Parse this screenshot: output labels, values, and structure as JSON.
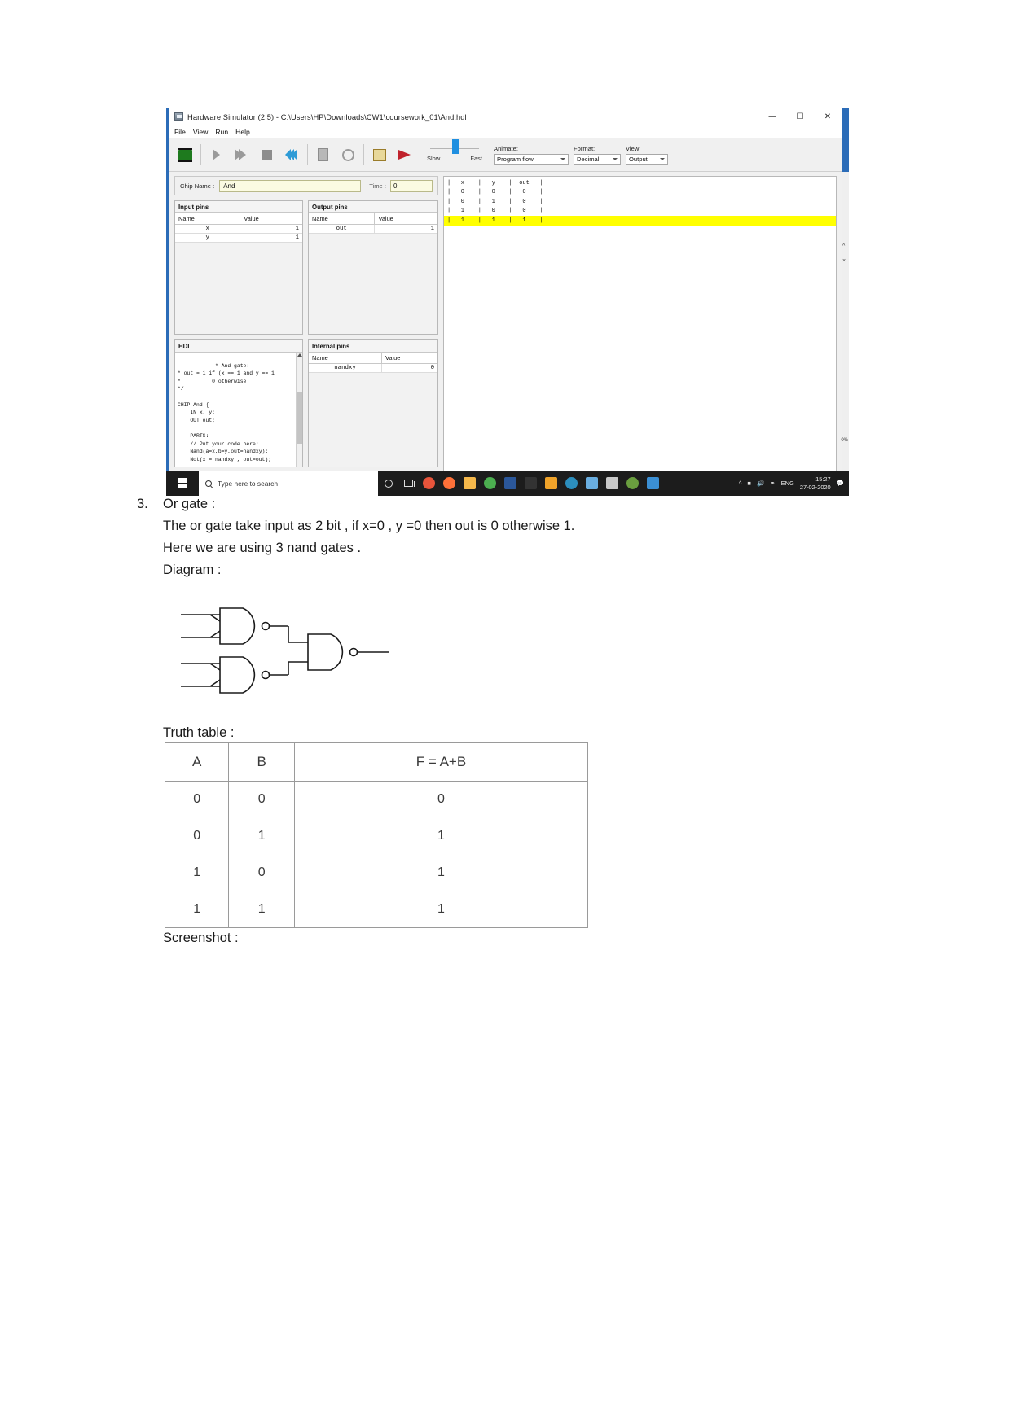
{
  "document": {
    "item_number": "3.",
    "lines": [
      "Or gate :",
      "The or gate take input as 2 bit , if x=0 , y =0 then out is 0 otherwise 1.",
      "Here we are using 3 nand gates .",
      "Diagram :"
    ],
    "truth_table_label": "Truth table :",
    "screenshot_label": "Screenshot :"
  },
  "truth_table": {
    "headers": [
      "A",
      "B",
      "F = A+B"
    ],
    "rows": [
      [
        "0",
        "0",
        "0"
      ],
      [
        "0",
        "1",
        "1"
      ],
      [
        "1",
        "0",
        "1"
      ],
      [
        "1",
        "1",
        "1"
      ]
    ]
  },
  "simulator": {
    "window_title": "Hardware Simulator (2.5) - C:\\Users\\HP\\Downloads\\CW1\\coursework_01\\And.hdl",
    "window_buttons": {
      "minimize": "—",
      "maximize": "☐",
      "close": "✕"
    },
    "menu": [
      "File",
      "View",
      "Run",
      "Help"
    ],
    "toolbar": {
      "icons": [
        "chip-icon",
        "step-icon",
        "fast-forward-icon",
        "stop-icon",
        "rewind-icon",
        "script-icon",
        "clock-icon",
        "compare-icon",
        "flag-icon"
      ],
      "speed_slow_label": "Slow",
      "speed_fast_label": "Fast",
      "animate_label": "Animate:",
      "animate_value": "Program flow",
      "format_label": "Format:",
      "format_value": "Decimal",
      "view_label": "View:",
      "view_value": "Output"
    },
    "chip": {
      "name_label": "Chip Name :",
      "name_value": "And",
      "time_label": "Time :",
      "time_value": "0"
    },
    "input_pins": {
      "title": "Input pins",
      "columns": [
        "Name",
        "Value"
      ],
      "rows": [
        {
          "name": "x",
          "value": "1"
        },
        {
          "name": "y",
          "value": "1"
        }
      ]
    },
    "output_pins": {
      "title": "Output pins",
      "columns": [
        "Name",
        "Value"
      ],
      "rows": [
        {
          "name": "out",
          "value": "1"
        }
      ]
    },
    "hdl": {
      "title": "HDL",
      "code": "* And gate:\n* out = 1 if (x == 1 and y == 1\n*          0 otherwise\n*/\n\nCHIP And {\n    IN x, y;\n    OUT out;\n\n    PARTS:\n    // Put your code here:\n    Nand(a=x,b=y,out=nandxy);\n    Not(x = nandxy , out=out);"
    },
    "internal_pins": {
      "title": "Internal pins",
      "columns": [
        "Name",
        "Value"
      ],
      "rows": [
        {
          "name": "nandxy",
          "value": "0"
        }
      ]
    },
    "sim_output": {
      "header": "|   x    |   y    |  out   |",
      "rows": [
        {
          "text": "|   0    |   0    |   0    |",
          "highlight": false
        },
        {
          "text": "|   0    |   1    |   0    |",
          "highlight": false
        },
        {
          "text": "|   1    |   0    |   0    |",
          "highlight": false
        },
        {
          "text": "|   1    |   1    |   1    |",
          "highlight": true
        }
      ]
    },
    "zoom_level": "0%"
  },
  "taskbar": {
    "search_placeholder": "Type here to search",
    "language": "ENG",
    "time": "15:27",
    "date": "27-02-2020",
    "app_colors": [
      "#e8543b",
      "#ff7139",
      "#f5b84b",
      "#4caf50",
      "#2b579a",
      "#333333",
      "#f0a32a",
      "#2c8ebd",
      "#6aaee0",
      "#6a9e3f",
      "#d46a2a",
      "#3b8fd4"
    ]
  },
  "colors": {
    "accent_blue": "#2b6cb8",
    "highlight_yellow": "#ffff00",
    "chip_field": "#fbfbe2",
    "taskbar_bg": "#1c1c1c"
  }
}
